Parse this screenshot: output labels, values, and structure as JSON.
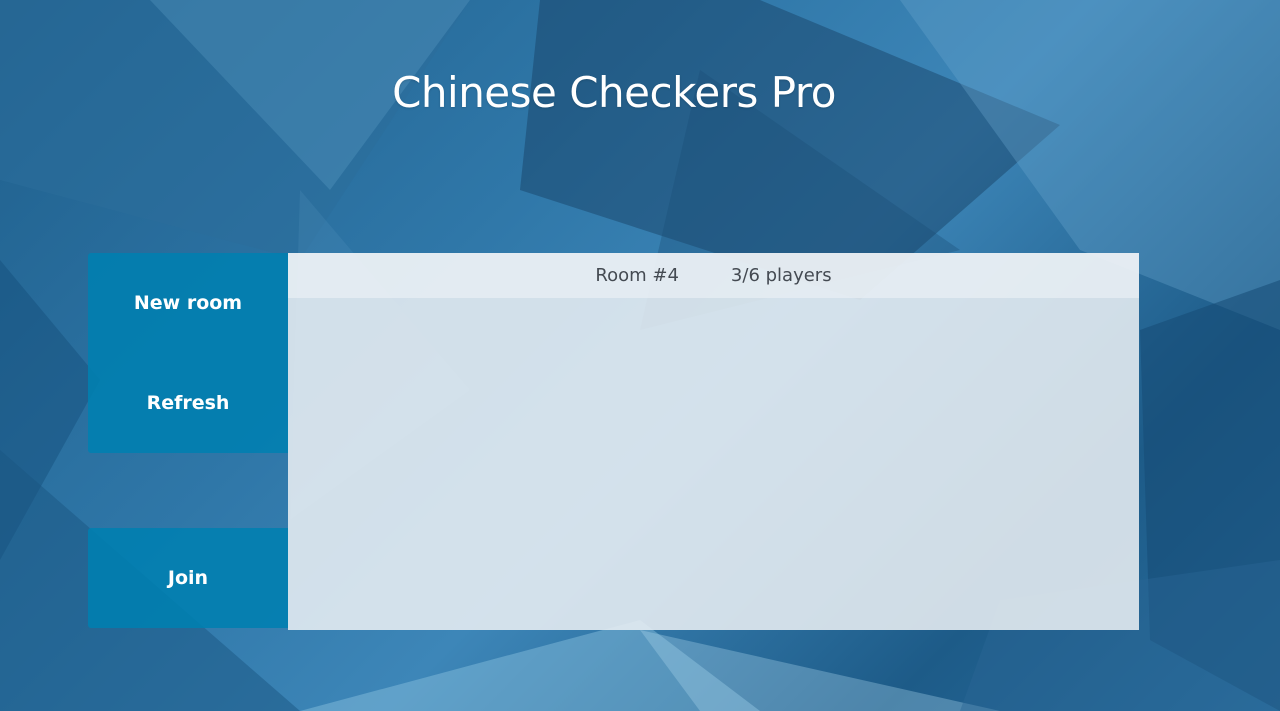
{
  "app": {
    "title": "Chinese Checkers Pro"
  },
  "sidebar": {
    "new_room_label": "New room",
    "refresh_label": "Refresh",
    "join_label": "Join"
  },
  "rooms": [
    {
      "name": "Room #4",
      "players": "3/6 players"
    }
  ],
  "colors": {
    "button": "#0080b0",
    "panel": "#e8eef3",
    "title_text": "#ffffff",
    "room_text": "#444a52"
  }
}
